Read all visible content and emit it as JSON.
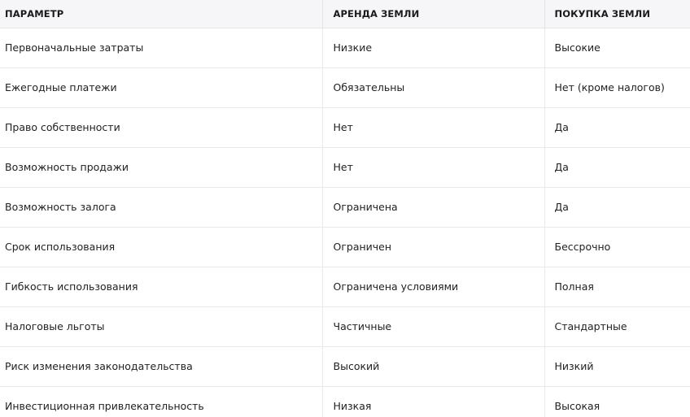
{
  "table": {
    "headers": [
      "ПАРАМЕТР",
      "АРЕНДА ЗЕМЛИ",
      "ПОКУПКА ЗЕМЛИ"
    ],
    "rows": [
      [
        "Первоначальные затраты",
        "Низкие",
        "Высокие"
      ],
      [
        "Ежегодные платежи",
        "Обязательны",
        "Нет (кроме налогов)"
      ],
      [
        "Право собственности",
        "Нет",
        "Да"
      ],
      [
        "Возможность продажи",
        "Нет",
        "Да"
      ],
      [
        "Возможность залога",
        "Ограничена",
        "Да"
      ],
      [
        "Срок использования",
        "Ограничен",
        "Бессрочно"
      ],
      [
        "Гибкость использования",
        "Ограничена условиями",
        "Полная"
      ],
      [
        "Налоговые льготы",
        "Частичные",
        "Стандартные"
      ],
      [
        "Риск изменения законодательства",
        "Высокий",
        "Низкий"
      ],
      [
        "Инвестиционная привлекательность",
        "Низкая",
        "Высокая"
      ]
    ]
  }
}
